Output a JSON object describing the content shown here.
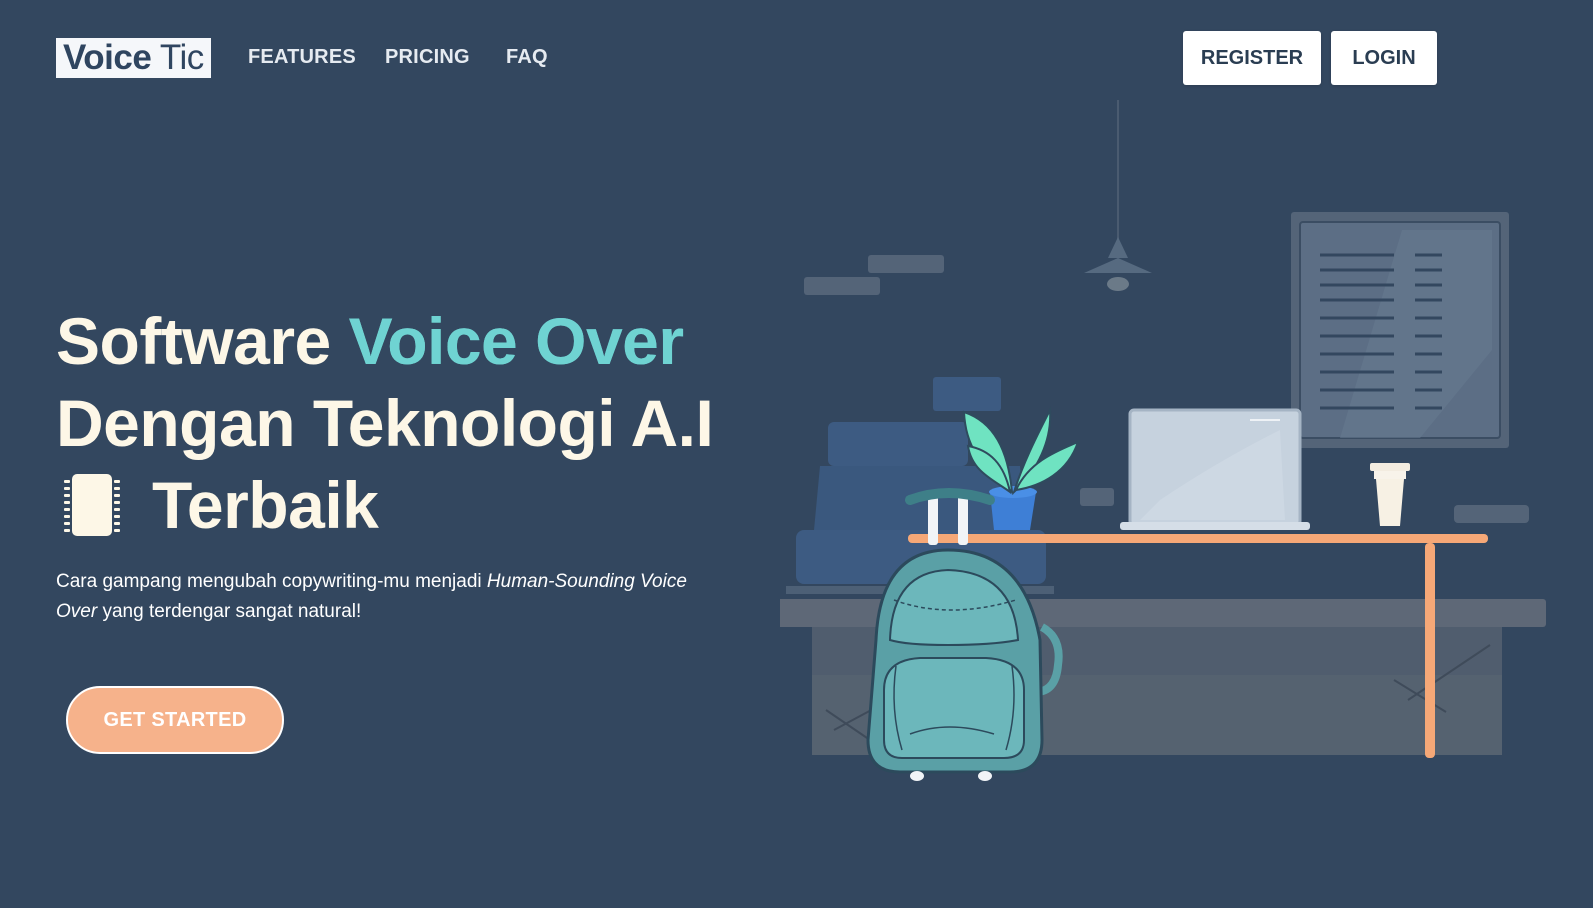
{
  "nav": {
    "logo_bold": "Voice",
    "logo_light": " Tic",
    "links": [
      {
        "label": "FEATURES"
      },
      {
        "label": "PRICING"
      },
      {
        "label": "FAQ"
      }
    ],
    "register_label": "REGISTER",
    "login_label": "LOGIN"
  },
  "hero": {
    "title_part1": "Software ",
    "title_accent": "Voice Over",
    "title_part2": "Dengan Teknologi A.I",
    "title_part3": "Terbaik",
    "title_icon": "notebook-icon",
    "subtitle_part1": "Cara gampang mengubah copywriting-mu menjadi ",
    "subtitle_italic": "Human-Sounding Voice Over",
    "subtitle_part2": " yang terdengar sangat natural!",
    "cta_label": "GET STARTED"
  },
  "colors": {
    "background": "#33475f",
    "accent_gradient_start": "#7be3d1",
    "accent_gradient_end": "#5fc4d4",
    "title_text": "#fdf7e7",
    "cta_background": "#f6b28b"
  },
  "illustration": {
    "icon": "desk-workspace-illustration"
  }
}
